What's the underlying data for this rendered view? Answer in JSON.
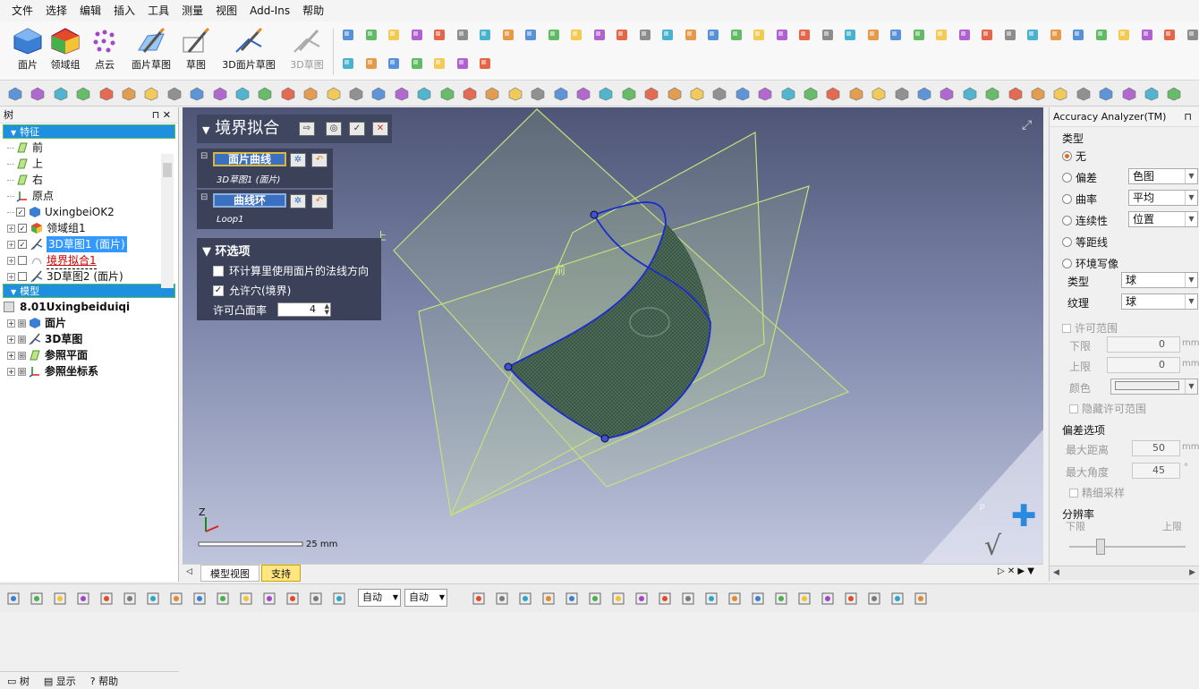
{
  "menu": [
    "文件",
    "选择",
    "编辑",
    "插入",
    "工具",
    "测量",
    "视图",
    "Add-Ins",
    "帮助"
  ],
  "ribbon": {
    "buttons": [
      {
        "label": "面片",
        "icon": "mesh-icon"
      },
      {
        "label": "领域组",
        "icon": "region-group-icon"
      },
      {
        "label": "点云",
        "icon": "point-cloud-icon"
      },
      {
        "label": "面片草图",
        "icon": "mesh-sketch-icon"
      },
      {
        "label": "草图",
        "icon": "sketch-icon"
      },
      {
        "label": "3D面片草图",
        "icon": "3d-mesh-sketch-icon"
      },
      {
        "label": "3D草图",
        "icon": "3d-sketch-icon",
        "disabled": true
      }
    ]
  },
  "left_panel": {
    "title": "树",
    "features_header": "特征",
    "features": [
      {
        "label": "前",
        "icon": "plane-icon",
        "checked": false,
        "expander": false
      },
      {
        "label": "上",
        "icon": "plane-icon",
        "checked": false,
        "expander": false
      },
      {
        "label": "右",
        "icon": "plane-icon",
        "checked": false,
        "expander": false
      },
      {
        "label": "原点",
        "icon": "origin-icon",
        "checked": false,
        "expander": false
      },
      {
        "label": "UxingbeiOK2",
        "icon": "mesh-icon",
        "checked": true,
        "expander": false
      },
      {
        "label": "领域组1",
        "icon": "region-group-icon",
        "checked": true,
        "expander": true
      },
      {
        "label": "3D草图1 (面片)",
        "icon": "3d-sketch-icon",
        "checked": true,
        "expander": true,
        "selected": true
      },
      {
        "label": "境界拟合1",
        "icon": "boundary-fit-icon",
        "checked": false,
        "expander": true,
        "error": true
      },
      {
        "label": "3D草图2 (面片)",
        "icon": "3d-sketch-icon",
        "checked": false,
        "expander": true
      }
    ],
    "model_header": "模型",
    "model_root": "8.01Uxingbeiduiqi",
    "model_items": [
      {
        "label": "面片",
        "icon": "mesh-icon"
      },
      {
        "label": "3D草图",
        "icon": "3d-sketch-icon"
      },
      {
        "label": "参照平面",
        "icon": "plane-icon"
      },
      {
        "label": "参照坐标系",
        "icon": "origin-icon"
      }
    ],
    "tabs": [
      "树",
      "显示",
      "帮助"
    ]
  },
  "fit_panel": {
    "title": "境界拟合",
    "mesh_curve_label": "面片曲线",
    "mesh_curve_value": "3D草图1 (面片)",
    "curve_loop_label": "曲线环",
    "curve_loop_value": "Loop1",
    "options_title": "环选项",
    "opt_use_normal": "环计算里使用面片的法线方向",
    "opt_use_normal_checked": false,
    "opt_allow_holes": "允许穴(境界)",
    "opt_allow_holes_checked": true,
    "convexity_label": "许可凸面率",
    "convexity_value": "4"
  },
  "viewport": {
    "label_top": "上",
    "label_front": "前",
    "scale_label": "25 mm",
    "axis_z": "Z"
  },
  "right_panel": {
    "title": "Accuracy Analyzer(TM)",
    "type_group": "类型",
    "types": [
      {
        "label": "无",
        "on": true
      },
      {
        "label": "偏差",
        "on": false,
        "dropdown": "色图"
      },
      {
        "label": "曲率",
        "on": false,
        "dropdown": "平均"
      },
      {
        "label": "连续性",
        "on": false,
        "dropdown": "位置"
      },
      {
        "label": "等距线",
        "on": false
      },
      {
        "label": "环境写像",
        "on": false
      }
    ],
    "env_type_label": "类型",
    "env_type_value": "球",
    "env_texture_label": "纹理",
    "env_texture_value": "球",
    "tolerance_group": "许可范围",
    "lower_label": "下限",
    "lower_value": "0",
    "upper_label": "上限",
    "upper_value": "0",
    "unit_mm": "mm",
    "color_label": "颜色",
    "hide_tolerance": "隐藏许可范围",
    "dev_group": "偏差选项",
    "max_dist_label": "最大距离",
    "max_dist_value": "50",
    "max_angle_label": "最大角度",
    "max_angle_value": "45",
    "deg_unit": "°",
    "fine_sampling": "精细采样",
    "resolution_group": "分辨率",
    "res_low": "下限",
    "res_high": "上限"
  },
  "bottom_tabs": [
    "模型视图",
    "支持"
  ],
  "status": {
    "dd1": "自动",
    "dd2": "自动"
  },
  "colors": {
    "accent": "#1f8fe0",
    "panel": "#3a4159",
    "mesh": "#4a6a58",
    "plane": "#c6e07a",
    "curve": "#1a2ccc"
  }
}
